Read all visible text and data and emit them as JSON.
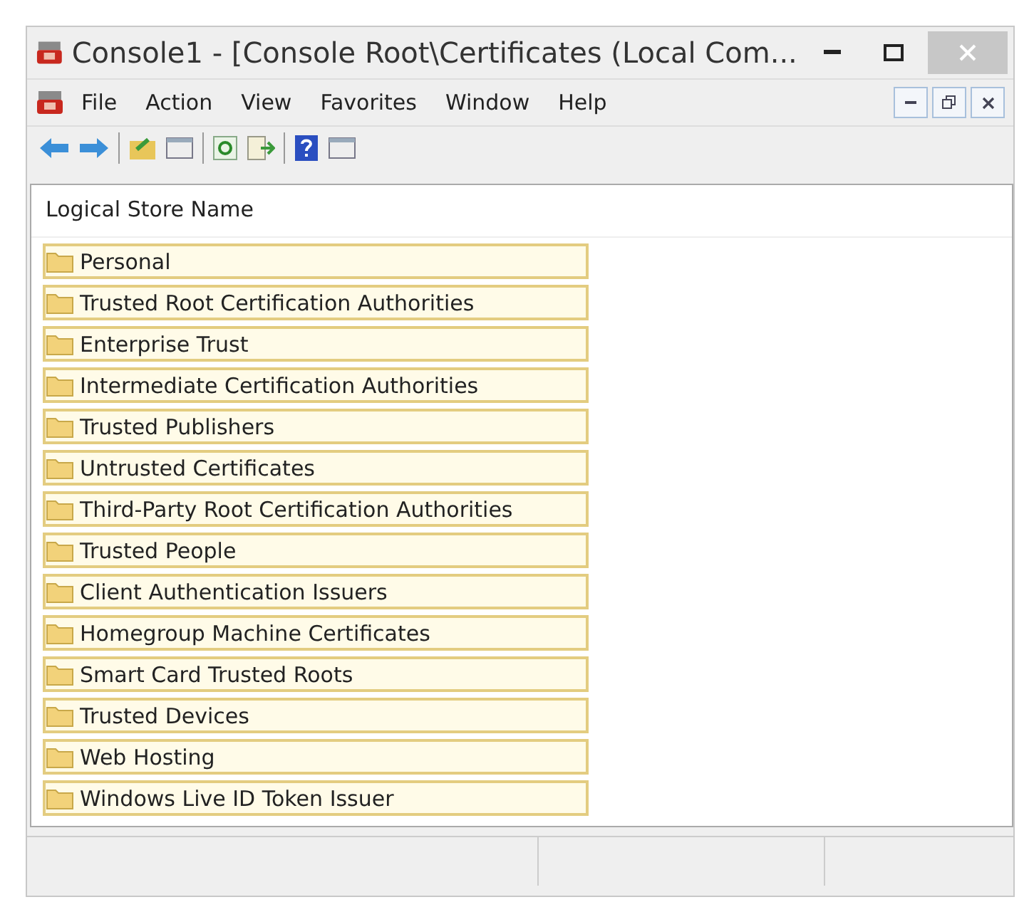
{
  "window": {
    "title": "Console1 - [Console Root\\Certificates (Local Com..."
  },
  "menu_bar": [
    "File",
    "Action",
    "View",
    "Favorites",
    "Window",
    "Help"
  ],
  "list": {
    "columns": [
      "Logical Store Name"
    ],
    "rows": [
      {
        "name": "Personal",
        "selected": true
      },
      {
        "name": "Trusted Root Certification Authorities",
        "selected": true
      },
      {
        "name": "Enterprise Trust",
        "selected": true
      },
      {
        "name": "Intermediate Certification Authorities",
        "selected": true
      },
      {
        "name": "Trusted Publishers",
        "selected": true
      },
      {
        "name": "Untrusted Certificates",
        "selected": true
      },
      {
        "name": "Third-Party Root Certification Authorities",
        "selected": true
      },
      {
        "name": "Trusted People",
        "selected": true
      },
      {
        "name": "Client Authentication Issuers",
        "selected": true
      },
      {
        "name": "Homegroup Machine Certificates",
        "selected": true
      },
      {
        "name": "Smart Card Trusted Roots",
        "selected": true
      },
      {
        "name": "Trusted Devices",
        "selected": true
      },
      {
        "name": "Web Hosting",
        "selected": true
      },
      {
        "name": "Windows Live ID Token Issuer",
        "selected": true
      }
    ]
  }
}
